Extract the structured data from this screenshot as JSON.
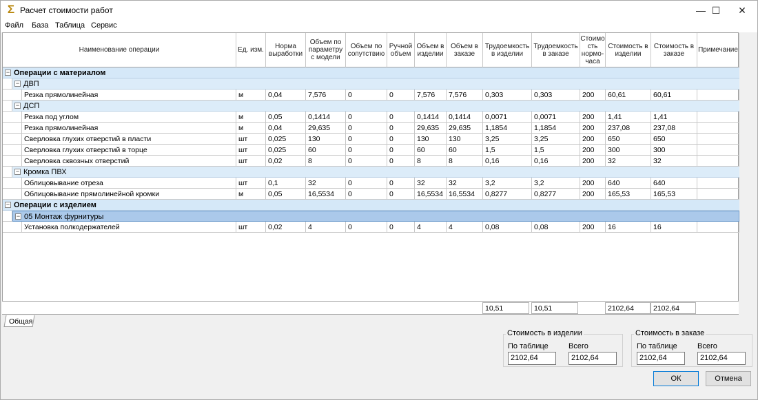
{
  "window": {
    "title": "Расчет стоимости работ",
    "app_icon": "sigma-icon",
    "minimize": "—",
    "maximize": "☐",
    "close": "✕"
  },
  "menu": [
    "Файл",
    "База",
    "Таблица",
    "Сервис"
  ],
  "columns": [
    "Наименование операции",
    "Ед. изм.",
    "Норма выработки",
    "Объем по параметру с модели",
    "Объем по сопутствию",
    "Ручной объем",
    "Объем в изделии",
    "Объем в заказе",
    "Трудоемкость в изделии",
    "Трудоемкость в заказе",
    "Стоимо сть нормо-часа",
    "Стоимость в изделии",
    "Стоимость в заказе",
    "Примечание"
  ],
  "groups": [
    {
      "label": "Операции с материалом",
      "subgroups": [
        {
          "label": "ДВП",
          "rows": [
            [
              "Резка прямолинейная",
              "м",
              "0,04",
              "7,576",
              "0",
              "0",
              "7,576",
              "7,576",
              "0,303",
              "0,303",
              "200",
              "60,61",
              "60,61",
              ""
            ]
          ]
        },
        {
          "label": "ДСП",
          "rows": [
            [
              "Резка под углом",
              "м",
              "0,05",
              "0,1414",
              "0",
              "0",
              "0,1414",
              "0,1414",
              "0,0071",
              "0,0071",
              "200",
              "1,41",
              "1,41",
              ""
            ],
            [
              "Резка прямолинейная",
              "м",
              "0,04",
              "29,635",
              "0",
              "0",
              "29,635",
              "29,635",
              "1,1854",
              "1,1854",
              "200",
              "237,08",
              "237,08",
              ""
            ],
            [
              "Сверловка глухих отверстий в пласти",
              "шт",
              "0,025",
              "130",
              "0",
              "0",
              "130",
              "130",
              "3,25",
              "3,25",
              "200",
              "650",
              "650",
              ""
            ],
            [
              "Сверловка глухих отверстий в торце",
              "шт",
              "0,025",
              "60",
              "0",
              "0",
              "60",
              "60",
              "1,5",
              "1,5",
              "200",
              "300",
              "300",
              ""
            ],
            [
              "Сверловка сквозных отверстий",
              "шт",
              "0,02",
              "8",
              "0",
              "0",
              "8",
              "8",
              "0,16",
              "0,16",
              "200",
              "32",
              "32",
              ""
            ]
          ]
        },
        {
          "label": "Кромка ПВХ",
          "rows": [
            [
              "Облицовывание отреза",
              "шт",
              "0,1",
              "32",
              "0",
              "0",
              "32",
              "32",
              "3,2",
              "3,2",
              "200",
              "640",
              "640",
              ""
            ],
            [
              "Облицовывание прямолинейной кромки",
              "м",
              "0,05",
              "16,5534",
              "0",
              "0",
              "16,5534",
              "16,5534",
              "0,8277",
              "0,8277",
              "200",
              "165,53",
              "165,53",
              ""
            ]
          ]
        }
      ]
    },
    {
      "label": "Операции с изделием",
      "subgroups": [
        {
          "label": "05 Монтаж фурнитуры",
          "selected": true,
          "rows": [
            [
              "Установка полкодержателей",
              "шт",
              "0,02",
              "4",
              "0",
              "0",
              "4",
              "4",
              "0,08",
              "0,08",
              "200",
              "16",
              "16",
              ""
            ]
          ]
        }
      ]
    }
  ],
  "totals": {
    "labor_item": "10,51",
    "labor_order": "10,51",
    "cost_item": "2102,64",
    "cost_order": "2102,64"
  },
  "tab": "Общая",
  "summary": {
    "item": {
      "title": "Стоимость в изделии",
      "by_table_label": "По таблице",
      "by_table": "2102,64",
      "total_label": "Всего",
      "total": "2102,64"
    },
    "order": {
      "title": "Стоимость в заказе",
      "by_table_label": "По таблице",
      "by_table": "2102,64",
      "total_label": "Всего",
      "total": "2102,64"
    }
  },
  "buttons": {
    "ok": "ОК",
    "cancel": "Отмена"
  }
}
